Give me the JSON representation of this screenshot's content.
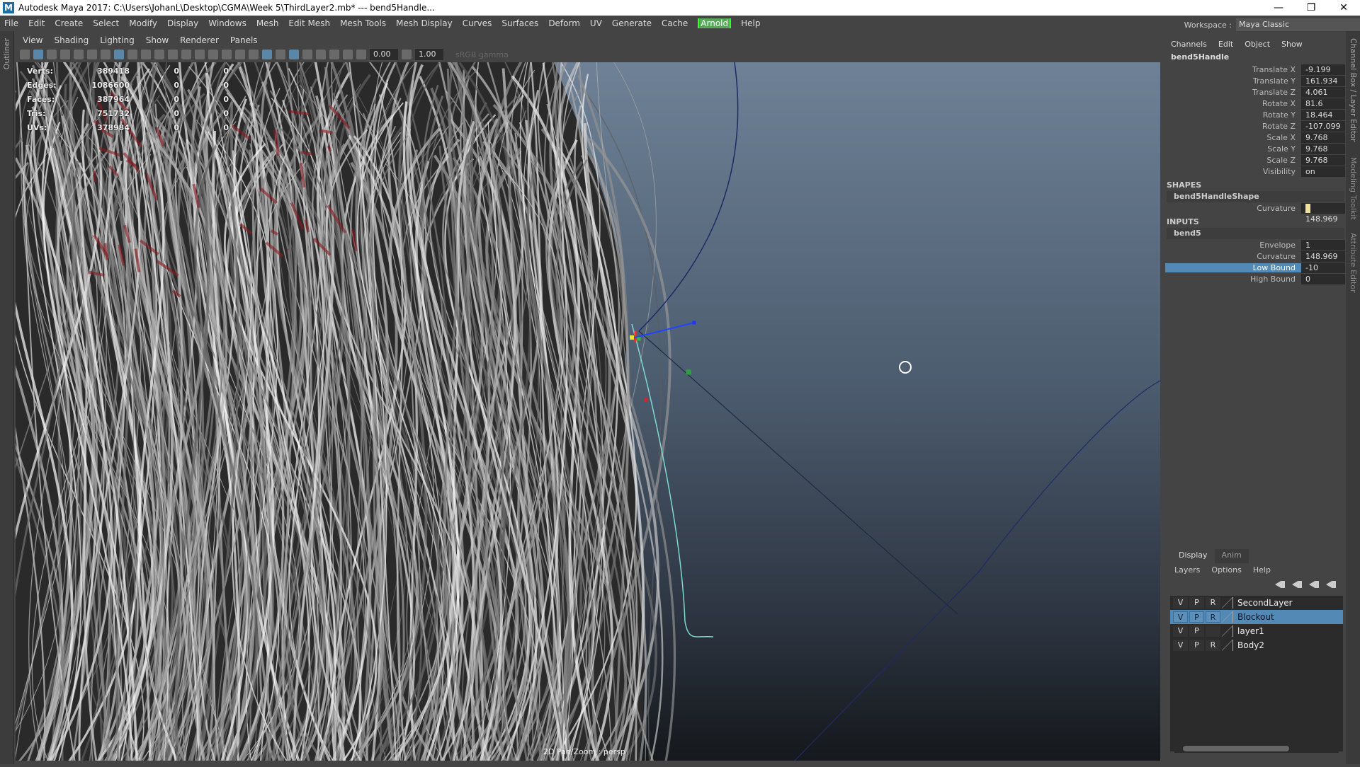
{
  "window": {
    "title": "Autodesk Maya 2017: C:\\Users\\JohanL\\Desktop\\CGMA\\Week 5\\ThirdLayer2.mb*  ---  bend5Handle...",
    "logo": "M",
    "controls": [
      "—",
      "❐",
      "✕"
    ]
  },
  "menubar": [
    "File",
    "Edit",
    "Create",
    "Select",
    "Modify",
    "Display",
    "Windows",
    "Mesh",
    "Edit Mesh",
    "Mesh Tools",
    "Mesh Display",
    "Curves",
    "Surfaces",
    "Deform",
    "UV",
    "Generate",
    "Cache",
    "Arnold",
    "Help"
  ],
  "outliner_label": "Outliner",
  "panel_menu": [
    "View",
    "Shading",
    "Lighting",
    "Show",
    "Renderer",
    "Panels"
  ],
  "toolbar": {
    "exposure": "0.00",
    "gamma": "1.00",
    "colorspace": "sRGB gamma"
  },
  "hud": [
    {
      "label": "Verts:",
      "value": "389418",
      "sel": "0",
      "comp": "0"
    },
    {
      "label": "Edges:",
      "value": "1086600",
      "sel": "0",
      "comp": "0"
    },
    {
      "label": "Faces:",
      "value": "387964",
      "sel": "0",
      "comp": "0"
    },
    {
      "label": "Tris:",
      "value": "751732",
      "sel": "0",
      "comp": "0"
    },
    {
      "label": "UVs:",
      "value": "378984",
      "sel": "0",
      "comp": "0"
    }
  ],
  "camera_label": "2D Pan/Zoom : persp",
  "workspace": {
    "label": "Workspace :",
    "value": "Maya Classic"
  },
  "channelbox": {
    "menu": [
      "Channels",
      "Edit",
      "Object",
      "Show"
    ],
    "object": "bend5Handle",
    "channels": [
      {
        "label": "Translate X",
        "value": "-9.199"
      },
      {
        "label": "Translate Y",
        "value": "161.934"
      },
      {
        "label": "Translate Z",
        "value": "4.061"
      },
      {
        "label": "Rotate X",
        "value": "81.6"
      },
      {
        "label": "Rotate Y",
        "value": "18.464"
      },
      {
        "label": "Rotate Z",
        "value": "-107.099"
      },
      {
        "label": "Scale X",
        "value": "9.768"
      },
      {
        "label": "Scale Y",
        "value": "9.768"
      },
      {
        "label": "Scale Z",
        "value": "9.768"
      },
      {
        "label": "Visibility",
        "value": "on"
      }
    ],
    "shapes_header": "SHAPES",
    "shape_name": "bend5HandleShape",
    "shape_channels": [
      {
        "label": "Curvature",
        "value": "148.969"
      }
    ],
    "inputs_header": "INPUTS",
    "input_name": "bend5",
    "input_channels": [
      {
        "label": "Envelope",
        "value": "1"
      },
      {
        "label": "Curvature",
        "value": "148.969"
      },
      {
        "label": "Low Bound",
        "value": "-10"
      },
      {
        "label": "High Bound",
        "value": "0"
      }
    ],
    "selected_channel": "Low Bound"
  },
  "side_tabs": [
    "Channel Box / Layer Editor",
    "Modeling Toolkit",
    "Attribute Editor"
  ],
  "layers": {
    "tabs": [
      "Display",
      "Anim"
    ],
    "menu": [
      "Layers",
      "Options",
      "Help"
    ],
    "items": [
      {
        "v": "V",
        "p": "P",
        "r": "R",
        "name": "SecondLayer"
      },
      {
        "v": "V",
        "p": "P",
        "r": "R",
        "name": "Blockout",
        "selected": true
      },
      {
        "v": "V",
        "p": "P",
        "r": "",
        "name": "layer1"
      },
      {
        "v": "V",
        "p": "P",
        "r": "R",
        "name": "Body2"
      }
    ]
  },
  "colors": {
    "selection": "#5289b5",
    "arnold": "#33ff33",
    "curvature_key": "#eee39a"
  }
}
